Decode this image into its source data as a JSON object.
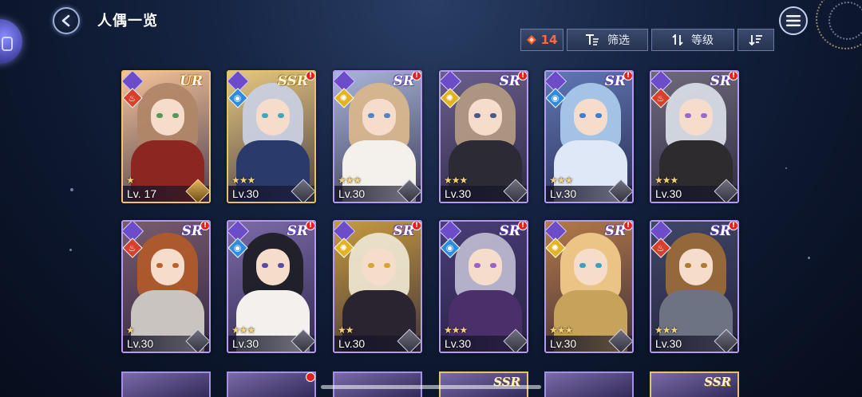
{
  "header": {
    "title": "人偶一览"
  },
  "toolbar": {
    "count": "14",
    "filter_label": "筛选",
    "sort_label": "等级"
  },
  "cards": [
    {
      "rarity": "UR",
      "level": "Lv. 17",
      "stars": "★",
      "attribute": "fire",
      "attr_icon": "flame-icon",
      "hair": "#b08668",
      "outfit": "#8b2620",
      "bg": "#f4c39a",
      "eyes": "#4f9a5a",
      "alert": ""
    },
    {
      "rarity": "SSR",
      "level": "Lv.30",
      "stars": "★★★",
      "attribute": "water",
      "attr_icon": "water-icon",
      "hair": "#c9cfdf",
      "outfit": "#2a3a6a",
      "bg": "#e7c77e",
      "eyes": "#3fa8c0",
      "alert": "!"
    },
    {
      "rarity": "SR",
      "level": "Lv.30",
      "stars": "★★★",
      "attribute": "light",
      "attr_icon": "sun-icon",
      "hair": "#d8b68d",
      "outfit": "#f4f1ec",
      "bg": "#a9b5d8",
      "eyes": "#4f86c9",
      "alert": "!"
    },
    {
      "rarity": "SR",
      "level": "Lv.30",
      "stars": "★★★",
      "attribute": "light",
      "attr_icon": "sun-icon",
      "hair": "#b19a82",
      "outfit": "#2b2a35",
      "bg": "#6b5e8c",
      "eyes": "#4a5a8a",
      "alert": "!"
    },
    {
      "rarity": "SR",
      "level": "Lv.30",
      "stars": "★★★",
      "attribute": "water",
      "attr_icon": "water-icon",
      "hair": "#a9c8ea",
      "outfit": "#dfe8f6",
      "bg": "#5f78b6",
      "eyes": "#3a7fd0",
      "alert": "!"
    },
    {
      "rarity": "SR",
      "level": "Lv.30",
      "stars": "★★★",
      "attribute": "fire",
      "attr_icon": "flame-icon",
      "hair": "#d7dbe5",
      "outfit": "#2d2b2e",
      "bg": "#6f6a7a",
      "eyes": "#9a6ad0",
      "alert": "!"
    },
    {
      "rarity": "SR",
      "level": "Lv.30",
      "stars": "★",
      "attribute": "fire",
      "attr_icon": "flame-icon",
      "hair": "#b05a2a",
      "outfit": "#c9c4c0",
      "bg": "#7a5b6e",
      "eyes": "#c0602a",
      "alert": "!"
    },
    {
      "rarity": "SR",
      "level": "Lv.30",
      "stars": "★★★",
      "attribute": "water",
      "attr_icon": "water-icon",
      "hair": "#1e1d26",
      "outfit": "#f3f0ee",
      "bg": "#7c6aa8",
      "eyes": "#5a4aa8",
      "alert": "!"
    },
    {
      "rarity": "SR",
      "level": "Lv.30",
      "stars": "★★",
      "attribute": "light",
      "attr_icon": "sun-icon",
      "hair": "#ece4cf",
      "outfit": "#2a2430",
      "bg": "#c69a3f",
      "eyes": "#d7a62a",
      "alert": "!"
    },
    {
      "rarity": "SR",
      "level": "Lv.30",
      "stars": "★★★",
      "attribute": "water",
      "attr_icon": "water-icon",
      "hair": "#bcb7cf",
      "outfit": "#4a2f6a",
      "bg": "#4a3d78",
      "eyes": "#9a60c8",
      "alert": "!"
    },
    {
      "rarity": "SR",
      "level": "Lv.30",
      "stars": "★★★",
      "attribute": "light",
      "attr_icon": "sun-icon",
      "hair": "#f0c98a",
      "outfit": "#c7a25a",
      "bg": "#b57a48",
      "eyes": "#3aa0c0",
      "alert": "!"
    },
    {
      "rarity": "SR",
      "level": "Lv.30",
      "stars": "★★★",
      "attribute": "fire",
      "attr_icon": "flame-icon",
      "hair": "#9a6a3a",
      "outfit": "#6e7384",
      "bg": "#3f4766",
      "eyes": "#b07a2a",
      "alert": "!"
    }
  ],
  "peek_cards": [
    {
      "rarity": "",
      "alert": ""
    },
    {
      "rarity": "",
      "alert": "!"
    },
    {
      "rarity": "",
      "alert": ""
    },
    {
      "rarity": "SSR",
      "alert": ""
    },
    {
      "rarity": "",
      "alert": ""
    },
    {
      "rarity": "SSR",
      "alert": ""
    }
  ]
}
